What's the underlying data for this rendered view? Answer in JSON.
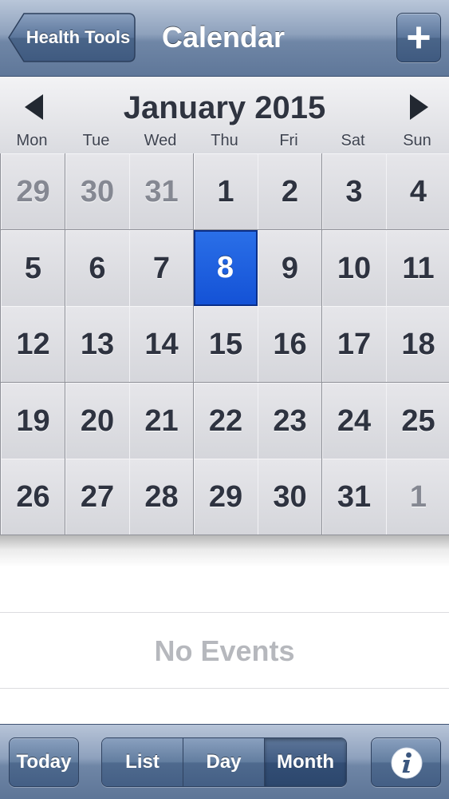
{
  "navbar": {
    "back_label": "Health Tools",
    "title": "Calendar",
    "add_icon": "plus-icon"
  },
  "calendar": {
    "month_title": "January 2015",
    "prev_icon": "triangle-left-icon",
    "next_icon": "triangle-right-icon",
    "weekdays": [
      "Mon",
      "Tue",
      "Wed",
      "Thu",
      "Fri",
      "Sat",
      "Sun"
    ],
    "weeks": [
      [
        {
          "day": "29",
          "current": false
        },
        {
          "day": "30",
          "current": false
        },
        {
          "day": "31",
          "current": false
        },
        {
          "day": "1",
          "current": true
        },
        {
          "day": "2",
          "current": true
        },
        {
          "day": "3",
          "current": true
        },
        {
          "day": "4",
          "current": true
        }
      ],
      [
        {
          "day": "5",
          "current": true
        },
        {
          "day": "6",
          "current": true
        },
        {
          "day": "7",
          "current": true
        },
        {
          "day": "8",
          "current": true
        },
        {
          "day": "9",
          "current": true
        },
        {
          "day": "10",
          "current": true
        },
        {
          "day": "11",
          "current": true
        }
      ],
      [
        {
          "day": "12",
          "current": true
        },
        {
          "day": "13",
          "current": true
        },
        {
          "day": "14",
          "current": true
        },
        {
          "day": "15",
          "current": true
        },
        {
          "day": "16",
          "current": true
        },
        {
          "day": "17",
          "current": true
        },
        {
          "day": "18",
          "current": true
        }
      ],
      [
        {
          "day": "19",
          "current": true
        },
        {
          "day": "20",
          "current": true
        },
        {
          "day": "21",
          "current": true
        },
        {
          "day": "22",
          "current": true
        },
        {
          "day": "23",
          "current": true
        },
        {
          "day": "24",
          "current": true
        },
        {
          "day": "25",
          "current": true
        }
      ],
      [
        {
          "day": "26",
          "current": true
        },
        {
          "day": "27",
          "current": true
        },
        {
          "day": "28",
          "current": true
        },
        {
          "day": "29",
          "current": true
        },
        {
          "day": "30",
          "current": true
        },
        {
          "day": "31",
          "current": true
        },
        {
          "day": "1",
          "current": false
        }
      ]
    ],
    "selected_day": "8"
  },
  "events": {
    "empty_text": "No Events"
  },
  "toolbar": {
    "today_label": "Today",
    "view_options": [
      "List",
      "Day",
      "Month"
    ],
    "selected_view": "Month",
    "info_icon": "info-icon"
  },
  "colors": {
    "selected_day": "#1452d6",
    "navbar": "#6f86a6"
  }
}
